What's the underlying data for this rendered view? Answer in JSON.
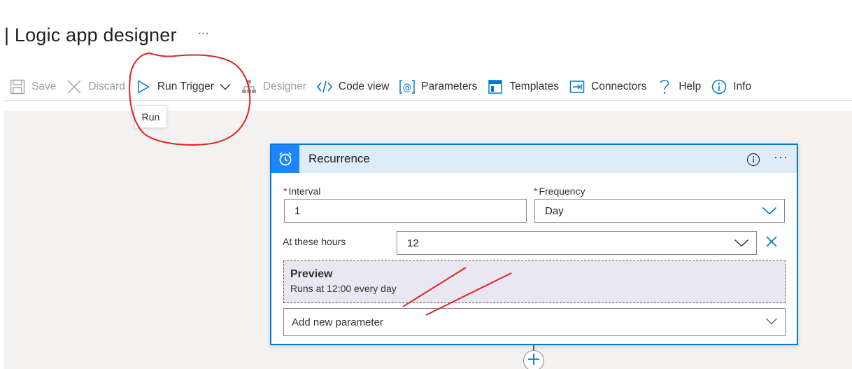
{
  "page": {
    "title": "| Logic app designer",
    "title_more": "···"
  },
  "toolbar": {
    "save": "Save",
    "discard": "Discard",
    "run_trigger": "Run Trigger",
    "designer": "Designer",
    "code_view": "Code view",
    "parameters": "Parameters",
    "templates": "Templates",
    "connectors": "Connectors",
    "help": "Help",
    "info": "Info"
  },
  "tooltip": {
    "run": "Run"
  },
  "card": {
    "title": "Recurrence",
    "more": "···",
    "interval": {
      "label": "Interval",
      "value": "1"
    },
    "frequency": {
      "label": "Frequency",
      "value": "Day"
    },
    "hours": {
      "label": "At these hours",
      "value": "12"
    },
    "preview": {
      "title": "Preview",
      "text": "Runs at 12:00 every day"
    },
    "add_parameter": "Add new parameter"
  },
  "icons": {
    "save": "save-icon",
    "discard": "discard-icon",
    "run": "play-icon",
    "designer": "designer-icon",
    "code": "code-icon",
    "parameters": "parameters-icon",
    "templates": "templates-icon",
    "connectors": "connectors-icon",
    "help": "help-icon",
    "info": "info-icon",
    "recurrence": "alarm-clock-icon"
  },
  "colors": {
    "accent": "#0078d4",
    "header_bg": "#deecf9",
    "badge": "#1f85ff",
    "annotation": "#e02424",
    "required": "#a4262c"
  }
}
